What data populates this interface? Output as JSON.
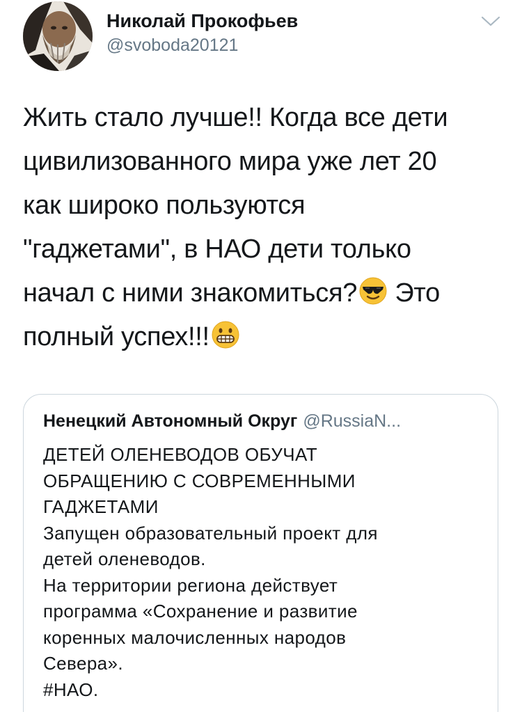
{
  "tweet": {
    "author": {
      "name": "Николай Прокофьев",
      "handle": "@svoboda20121"
    },
    "text_lines": [
      "Жить стало лучше!! Когда все дети",
      "цивилизованного мира уже лет 20",
      "как широко пользуются",
      "\"гаджетами\", в НАО дети только",
      "начал с ними знакомиться?",
      "Это",
      "полный успех!!!"
    ],
    "emojis": [
      "smiling-face-with-sunglasses",
      "grimacing-face"
    ]
  },
  "quote": {
    "author_name": "Ненецкий Автономный Округ",
    "author_handle": "@RussiaN...",
    "lines": [
      "ДЕТЕЙ ОЛЕНЕВОДОВ ОБУЧАТ",
      "ОБРАЩЕНИЮ С СОВРЕМЕННЫМИ",
      "ГАДЖЕТАМИ",
      "Запущен образовательный проект для",
      "детей оленеводов.",
      "На территории региона действует",
      "программа «Сохранение и развитие",
      "коренных малочисленных народов",
      "Севера».",
      "#НАО."
    ]
  },
  "colors": {
    "text": "#14171a",
    "secondary": "#657786",
    "border": "#ccd6dd"
  }
}
